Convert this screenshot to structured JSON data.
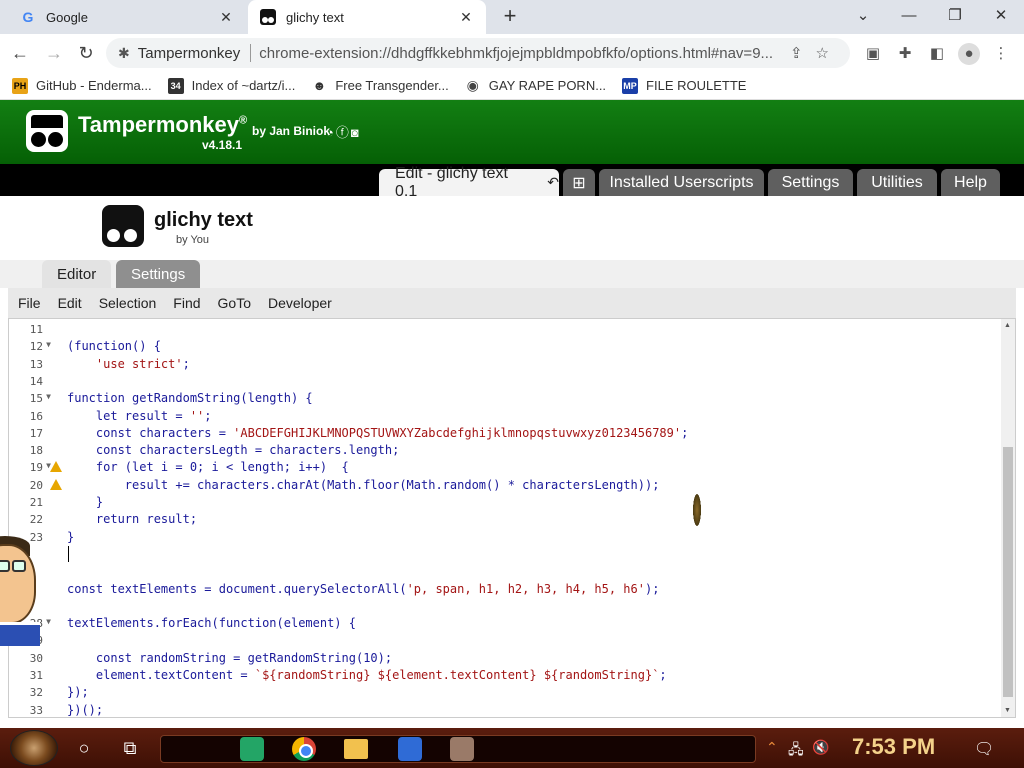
{
  "browser": {
    "tabs": [
      {
        "title": "Google",
        "favicon": "G"
      },
      {
        "title": "glichy text",
        "favicon": "TM"
      }
    ],
    "omnibox": {
      "site": "Tampermonkey",
      "url": "chrome-extension://dhdgffkkebhmkfjojejmpbldmpobfkfo/options.html#nav=9..."
    },
    "bookmarks": [
      {
        "label": "GitHub - Enderma...",
        "icon": "PH",
        "color": "#e8a317"
      },
      {
        "label": "Index of ~dartz/i...",
        "icon": "34",
        "color": "#333333"
      },
      {
        "label": "Free Transgender...",
        "icon": "mask",
        "color": "#ffffff"
      },
      {
        "label": "GAY RAPE PORN...",
        "icon": "globe",
        "color": "#ffffff"
      },
      {
        "label": "FILE ROULETTE",
        "icon": "MP",
        "color": "#1a3fa8"
      }
    ]
  },
  "tampermonkey": {
    "title": "Tampermonkey",
    "registered": "®",
    "by": "by Jan Biniok",
    "version": "v4.18.1",
    "nav": {
      "active_tab": "Edit - glichy text 0.1",
      "add_symbol": "⊞",
      "tabs": [
        "Installed Userscripts",
        "Settings",
        "Utilities",
        "Help"
      ]
    },
    "script": {
      "name": "glichy text",
      "author": "by You"
    },
    "subtabs": [
      "Editor",
      "Settings"
    ],
    "menu": [
      "File",
      "Edit",
      "Selection",
      "Find",
      "GoTo",
      "Developer"
    ]
  },
  "editor": {
    "lines": [
      {
        "n": "11",
        "fold": false,
        "warn": false,
        "text": ""
      },
      {
        "n": "12",
        "fold": true,
        "warn": false,
        "text": "(function() {"
      },
      {
        "n": "13",
        "fold": false,
        "warn": false,
        "text": "    'use strict';"
      },
      {
        "n": "14",
        "fold": false,
        "warn": false,
        "text": ""
      },
      {
        "n": "15",
        "fold": true,
        "warn": false,
        "text": "function getRandomString(length) {"
      },
      {
        "n": "16",
        "fold": false,
        "warn": false,
        "text": "    let result = '';"
      },
      {
        "n": "17",
        "fold": false,
        "warn": false,
        "text": "    const characters = 'ABCDEFGHIJKLMNOPQSTUVWXYZabcdefghijklmnopqstuvwxyz0123456789';"
      },
      {
        "n": "18",
        "fold": false,
        "warn": false,
        "text": "    const charactersLegth = characters.length;"
      },
      {
        "n": "19",
        "fold": true,
        "warn": true,
        "text": "    for (let i = 0; i < length; i++)  {"
      },
      {
        "n": "20",
        "fold": false,
        "warn": true,
        "text": "        result += characters.charAt(Math.floor(Math.random() * charactersLength));"
      },
      {
        "n": "21",
        "fold": false,
        "warn": false,
        "text": "    }"
      },
      {
        "n": "22",
        "fold": false,
        "warn": false,
        "text": "    return result;"
      },
      {
        "n": "23",
        "fold": false,
        "warn": false,
        "text": "}"
      },
      {
        "n": "",
        "fold": false,
        "warn": false,
        "text": ""
      },
      {
        "n": "",
        "fold": false,
        "warn": false,
        "text": ""
      },
      {
        "n": "",
        "fold": false,
        "warn": false,
        "text": "const textElements = document.querySelectorAll('p, span, h1, h2, h3, h4, h5, h6');"
      },
      {
        "n": "",
        "fold": false,
        "warn": false,
        "text": ""
      },
      {
        "n": "28",
        "fold": true,
        "warn": false,
        "text": "textElements.forEach(function(element) {"
      },
      {
        "n": "29",
        "fold": false,
        "warn": false,
        "text": ""
      },
      {
        "n": "30",
        "fold": false,
        "warn": false,
        "text": "    const randomString = getRandomString(10);"
      },
      {
        "n": "31",
        "fold": false,
        "warn": false,
        "text": "    element.textContent = `${randomString} ${element.textContent} ${randomString}`;"
      },
      {
        "n": "32",
        "fold": false,
        "warn": false,
        "text": "});"
      },
      {
        "n": "33",
        "fold": false,
        "warn": false,
        "text": "})();"
      }
    ]
  },
  "taskbar": {
    "time": "7:53 PM",
    "notification_count": "4"
  },
  "colors": {
    "tm_green": "#0b7a0b",
    "code_keyword": "#1a1a9a",
    "code_string": "#a31515",
    "warning": "#e7a600"
  }
}
